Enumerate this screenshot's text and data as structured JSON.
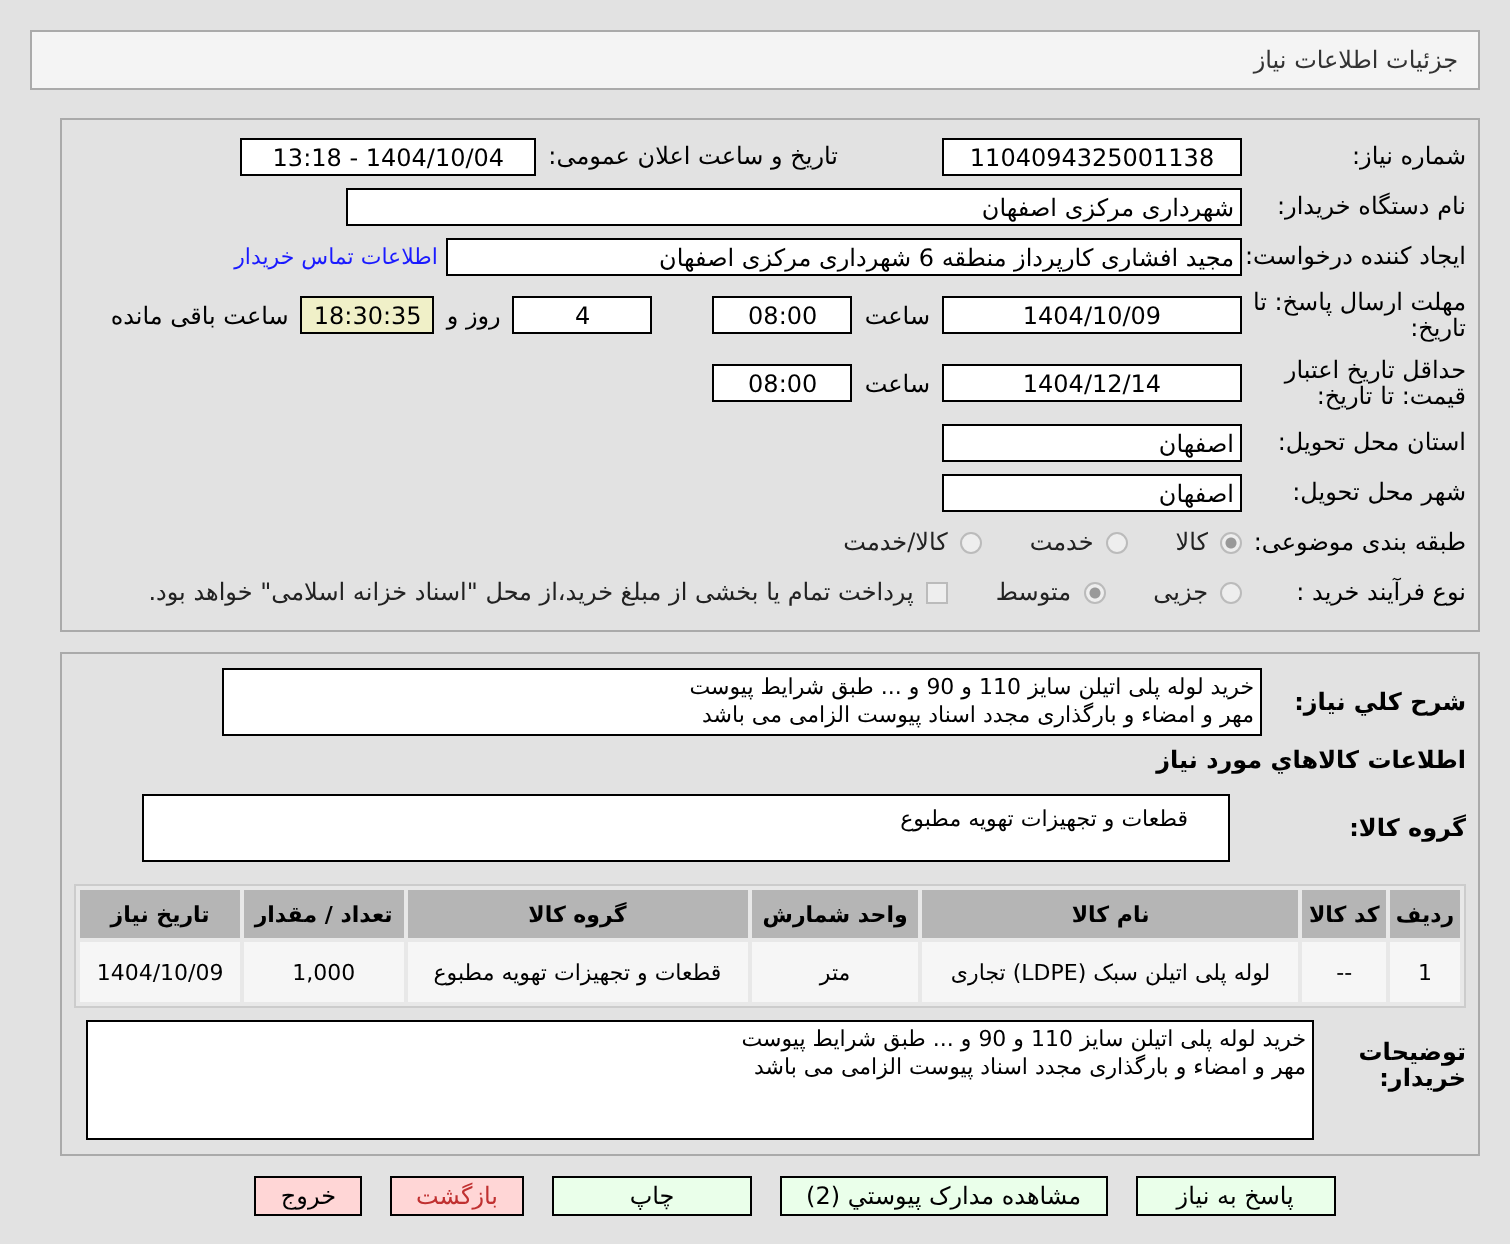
{
  "header": {
    "title": "جزئیات اطلاعات نیاز"
  },
  "need_number": {
    "label": "شماره نیاز:",
    "value": "1104094325001138"
  },
  "announce": {
    "label": "تاریخ و ساعت اعلان عمومی:",
    "value": "1404/10/04 - 13:18"
  },
  "buyer_org": {
    "label": "نام دستگاه خریدار:",
    "value": "شهرداری مرکزی اصفهان"
  },
  "requester": {
    "label": "ایجاد کننده درخواست:",
    "value": "مجید افشاری کارپرداز منطقه 6 شهرداری مرکزی اصفهان",
    "link": "اطلاعات تماس خریدار"
  },
  "deadline": {
    "label": "مهلت ارسال پاسخ: تا تاریخ:",
    "date": "1404/10/09",
    "time_label": "ساعت",
    "time": "08:00",
    "days": "4",
    "days_label": "روز و",
    "remaining": "18:30:35",
    "remaining_label": "ساعت باقی مانده"
  },
  "validity": {
    "label": "حداقل تاریخ اعتبار قیمت: تا تاریخ:",
    "date": "1404/12/14",
    "time_label": "ساعت",
    "time": "08:00"
  },
  "province": {
    "label": "استان محل تحویل:",
    "value": "اصفهان"
  },
  "city": {
    "label": "شهر محل تحویل:",
    "value": "اصفهان"
  },
  "category": {
    "label": "طبقه بندی موضوعی:",
    "options": [
      {
        "label": "کالا",
        "selected": true
      },
      {
        "label": "خدمت",
        "selected": false
      },
      {
        "label": "کالا/خدمت",
        "selected": false
      }
    ]
  },
  "process": {
    "label": "نوع فرآیند خرید :",
    "options": [
      {
        "label": "جزیی",
        "selected": false
      },
      {
        "label": "متوسط",
        "selected": true
      }
    ],
    "payment": {
      "checked": false,
      "text": "پرداخت تمام یا بخشی از مبلغ خرید،از محل \"اسناد خزانه اسلامی\" خواهد بود."
    }
  },
  "summary": {
    "label": "شرح کلي نیاز:",
    "text": "خرید لوله پلی اتیلن سایز 110 و 90 و ... طبق شرایط پیوست\nمهر و امضاء و بارگذاری مجدد اسناد پیوست الزامی می باشد"
  },
  "goods_title": "اطلاعات کالاهاي مورد نیاز",
  "goods_group": {
    "label": "گروه کالا:",
    "value": "قطعات و تجهیزات تهویه مطبوع"
  },
  "table": {
    "columns": [
      "ردیف",
      "کد کالا",
      "نام کالا",
      "واحد شمارش",
      "گروه کالا",
      "تعداد / مقدار",
      "تاریخ نیاز"
    ],
    "rows": [
      [
        "1",
        "--",
        "لوله پلی اتیلن سبک (LDPE) تجاری",
        "متر",
        "قطعات و تجهیزات تهویه مطبوع",
        "1,000",
        "1404/10/09"
      ]
    ]
  },
  "notes": {
    "label": "توضیحات خریدار:",
    "text": "خرید لوله پلی اتیلن سایز 110 و 90 و ... طبق شرایط پیوست\nمهر و امضاء و بارگذاری مجدد اسناد پیوست الزامی می باشد"
  },
  "buttons": [
    {
      "label": "پاسخ به نیاز",
      "kind": "normal"
    },
    {
      "label": "مشاهده مدارک پیوستي (2)",
      "kind": "normal"
    },
    {
      "label": "چاپ",
      "kind": "normal"
    },
    {
      "label": "بازگشت",
      "kind": "back"
    },
    {
      "label": "خروج",
      "kind": "exit"
    }
  ]
}
